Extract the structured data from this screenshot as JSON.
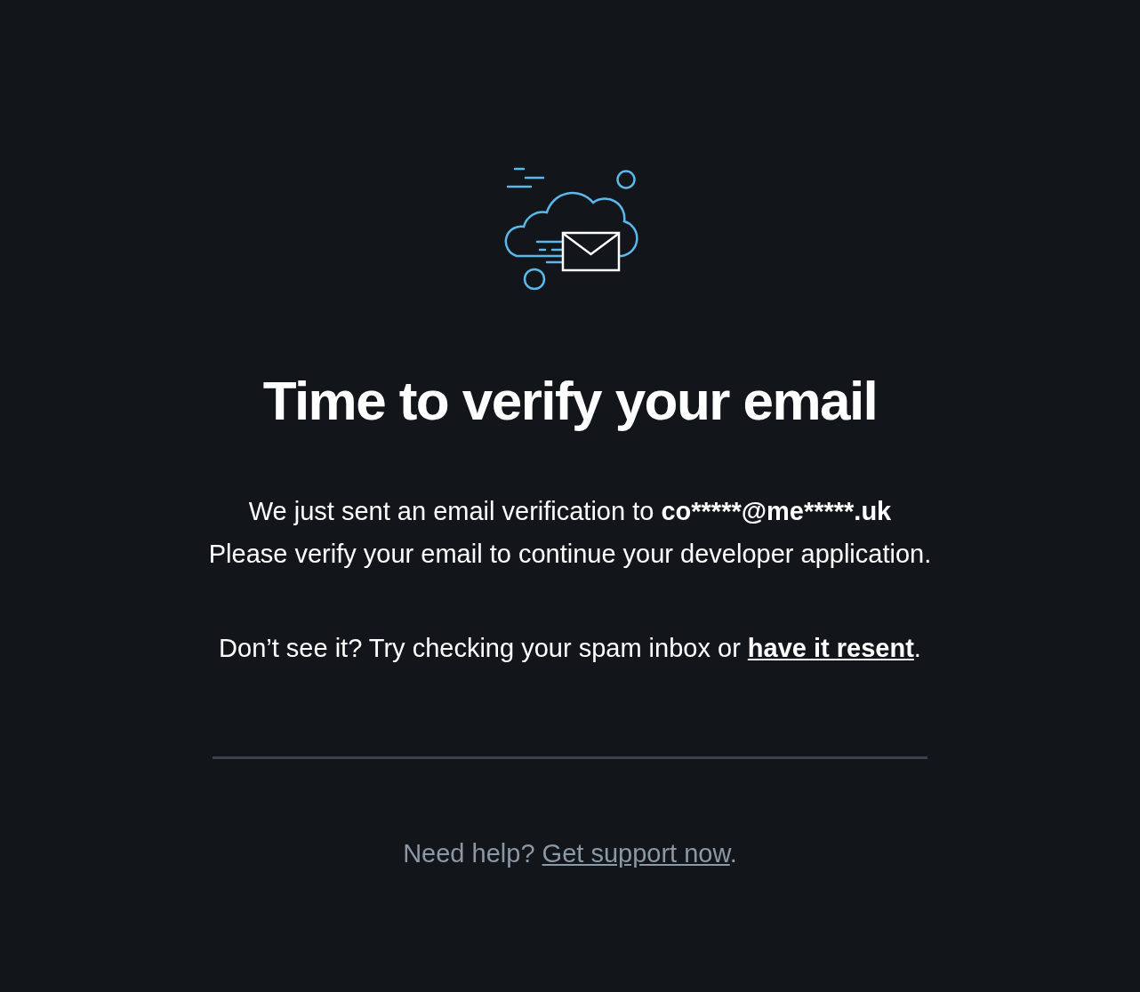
{
  "heading": "Time to verify your email",
  "message": {
    "sent_text": "We just sent an email verification to",
    "email": "co*****@me*****.uk",
    "instruction": "Please verify your email to continue your developer application."
  },
  "resend": {
    "before": "Don’t see it? Try checking your spam inbox or",
    "link": "have it resent",
    "after": "."
  },
  "help": {
    "before": "Need help?",
    "link": "Get support now",
    "after": "."
  }
}
